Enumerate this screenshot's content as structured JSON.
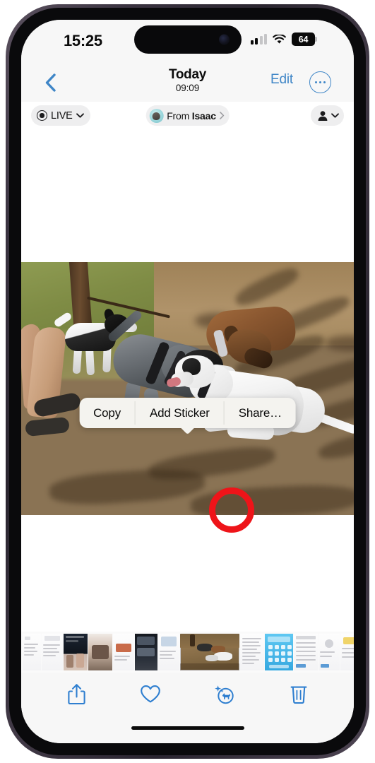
{
  "status_bar": {
    "time": "15:25",
    "signal_icon": "cellular-signal-icon",
    "signal_bars_filled": 2,
    "signal_bars_total": 4,
    "wifi_icon": "wifi-icon",
    "battery_level": "64",
    "battery_icon": "battery-icon"
  },
  "nav_bar": {
    "back_icon": "chevron-left-icon",
    "title": "Today",
    "subtitle": "09:09",
    "edit_label": "Edit",
    "more_icon": "ellipsis-circle-icon"
  },
  "sub_toolbar": {
    "live_label": "LIVE",
    "live_icon": "live-photo-icon",
    "live_chevron_icon": "chevron-down-icon",
    "from_prefix": "From ",
    "from_name": "Isaac",
    "from_avatar_icon": "contact-avatar-icon",
    "from_chevron_icon": "chevron-right-icon",
    "people_icon": "person-icon",
    "people_chevron_icon": "chevron-down-icon"
  },
  "context_menu": {
    "items": [
      {
        "label": "Copy",
        "name": "copy"
      },
      {
        "label": "Add Sticker",
        "name": "add-sticker"
      },
      {
        "label": "Share…",
        "name": "share"
      }
    ]
  },
  "photo": {
    "description": "Dogs playing in a dirt dog park under tree shade",
    "annotation_color": "#ee1419",
    "annotation_shape": "circle"
  },
  "filmstrip": {
    "selected_index": 7,
    "thumbnails": [
      {
        "kind": "doc",
        "width": 26
      },
      {
        "kind": "doc",
        "width": 30
      },
      {
        "kind": "dark",
        "width": 34
      },
      {
        "kind": "photo-people",
        "width": 34
      },
      {
        "kind": "doc",
        "width": 30
      },
      {
        "kind": "dark",
        "width": 32
      },
      {
        "kind": "doc",
        "width": 30
      },
      {
        "kind": "photo-dogs",
        "width": 84
      },
      {
        "kind": "doc",
        "width": 34
      },
      {
        "kind": "screen-blue",
        "width": 40
      },
      {
        "kind": "doc-list",
        "width": 34
      },
      {
        "kind": "doc",
        "width": 30
      },
      {
        "kind": "doc-yellow",
        "width": 30
      },
      {
        "kind": "doc",
        "width": 30
      },
      {
        "kind": "doc",
        "width": 30
      },
      {
        "kind": "doc",
        "width": 30
      }
    ]
  },
  "bottom_toolbar": {
    "buttons": [
      {
        "name": "share-button",
        "icon": "share-upload-icon"
      },
      {
        "name": "favorite-button",
        "icon": "heart-icon"
      },
      {
        "name": "visual-lookup-button",
        "icon": "visual-lookup-dog-icon"
      },
      {
        "name": "delete-button",
        "icon": "trash-icon"
      }
    ],
    "tint_color": "#2f7fd0"
  }
}
